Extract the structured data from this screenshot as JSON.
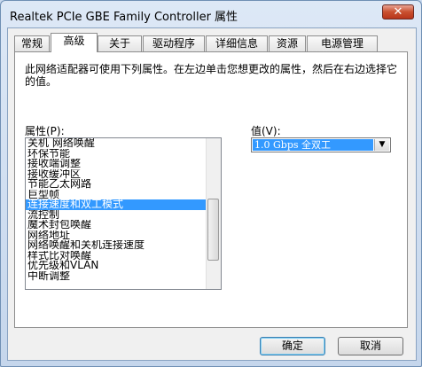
{
  "window": {
    "title": "Realtek PCIe GBE Family Controller 属性",
    "close_label": "✕"
  },
  "tabs": [
    {
      "label": "常规"
    },
    {
      "label": "高级"
    },
    {
      "label": "关于"
    },
    {
      "label": "驱动程序"
    },
    {
      "label": "详细信息"
    },
    {
      "label": "资源"
    },
    {
      "label": "电源管理"
    }
  ],
  "active_tab": "高级",
  "panel": {
    "description": "此网络适配器可使用下列属性。在左边单击您想更改的属性，然后在右边选择它的值。",
    "properties_label": "属性(P):",
    "value_label": "值(V):"
  },
  "properties": [
    "关机 网络唤醒",
    "环保节能",
    "接收端调整",
    "接收缓冲区",
    "节能乙太网路",
    "巨型帧",
    "连接速度和双工模式",
    "流控制",
    "魔术封包唤醒",
    "网络地址",
    "网络唤醒和关机连接速度",
    "样式比对唤醒",
    "优先级和VLAN",
    "中断调整"
  ],
  "selected_property": "连接速度和双工模式",
  "value_select": {
    "selected": "1.0 Gbps 全双工"
  },
  "buttons": {
    "ok": "确定",
    "cancel": "取消"
  },
  "colors": {
    "selection": "#3399ff",
    "client_bg": "#f0f0f0"
  }
}
